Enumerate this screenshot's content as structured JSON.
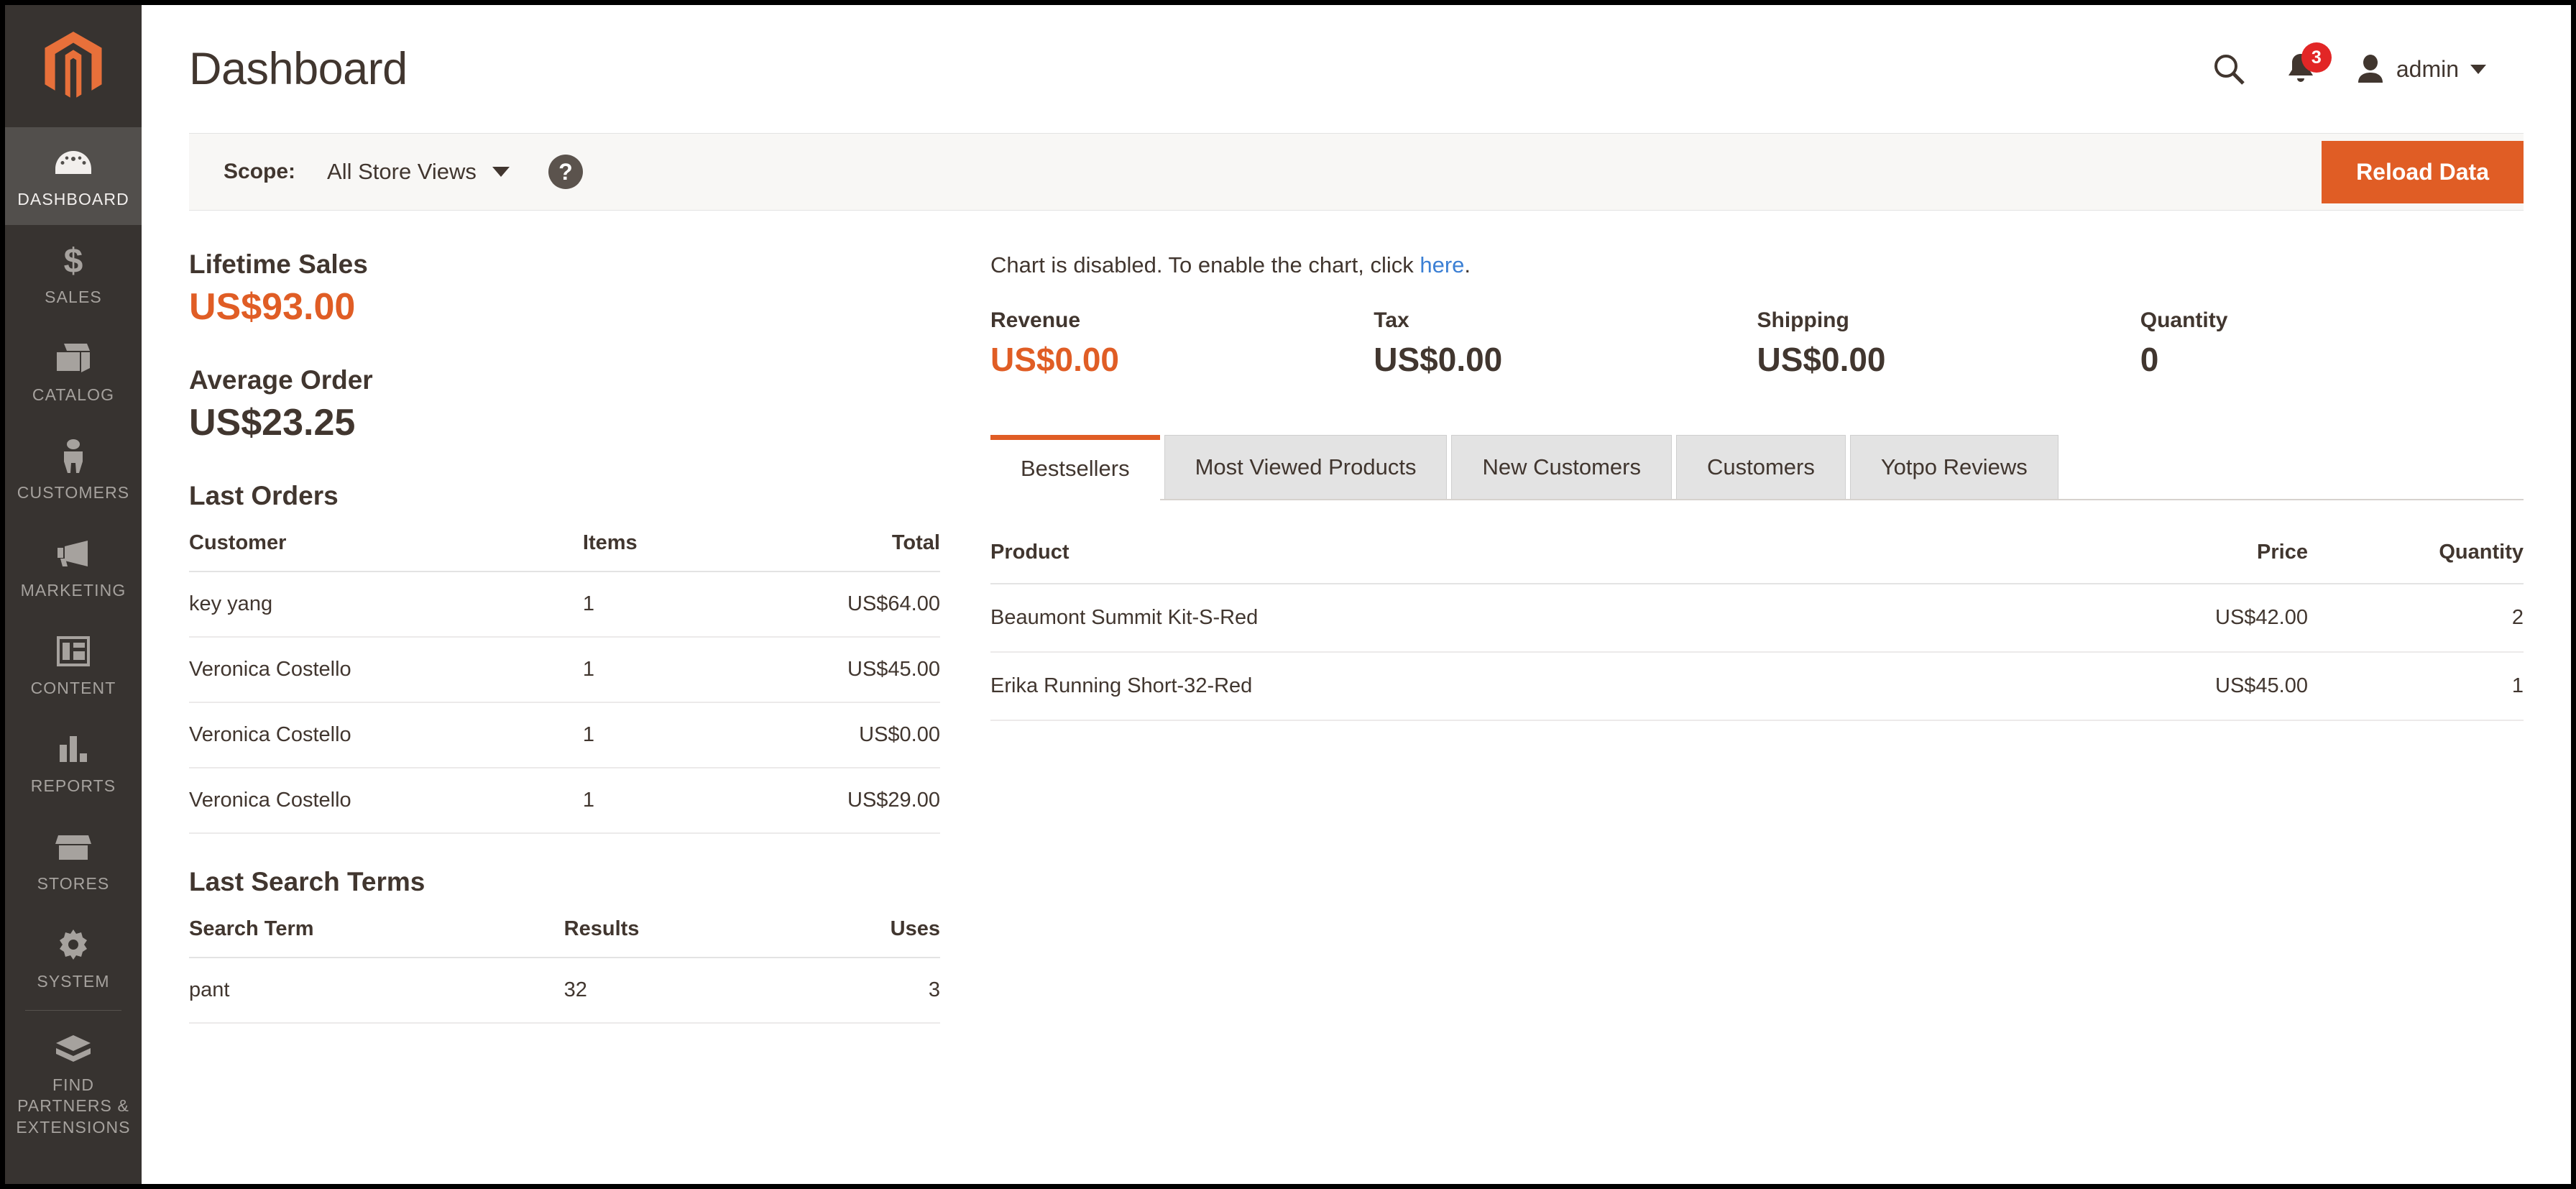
{
  "sidebar": {
    "logo": "magento-logo-icon",
    "items": [
      {
        "label": "DASHBOARD",
        "icon": "dashboard-gauge-icon",
        "active": true
      },
      {
        "label": "SALES",
        "icon": "dollar-sign-icon",
        "active": false
      },
      {
        "label": "CATALOG",
        "icon": "box-icon",
        "active": false
      },
      {
        "label": "CUSTOMERS",
        "icon": "person-icon",
        "active": false
      },
      {
        "label": "MARKETING",
        "icon": "megaphone-icon",
        "active": false
      },
      {
        "label": "CONTENT",
        "icon": "layout-page-icon",
        "active": false
      },
      {
        "label": "REPORTS",
        "icon": "bar-chart-icon",
        "active": false
      },
      {
        "label": "STORES",
        "icon": "storefront-icon",
        "active": false
      },
      {
        "label": "SYSTEM",
        "icon": "gear-icon",
        "active": false
      },
      {
        "label": "FIND PARTNERS & EXTENSIONS",
        "icon": "extensions-blocks-icon",
        "active": false
      }
    ]
  },
  "header": {
    "title": "Dashboard",
    "search_icon": "search-icon",
    "notifications_icon": "bell-icon",
    "notifications_count": "3",
    "user_icon": "user-avatar-icon",
    "user_name": "admin"
  },
  "scope": {
    "label": "Scope:",
    "value": "All Store Views",
    "help_icon": "question-mark-icon",
    "help_label": "?",
    "reload_label": "Reload Data"
  },
  "lifetime_sales": {
    "title": "Lifetime Sales",
    "value": "US$93.00"
  },
  "average_order": {
    "title": "Average Order",
    "value": "US$23.25"
  },
  "last_orders": {
    "title": "Last Orders",
    "columns": [
      "Customer",
      "Items",
      "Total"
    ],
    "rows": [
      {
        "customer": "key yang",
        "items": "1",
        "total": "US$64.00"
      },
      {
        "customer": "Veronica Costello",
        "items": "1",
        "total": "US$45.00"
      },
      {
        "customer": "Veronica Costello",
        "items": "1",
        "total": "US$0.00"
      },
      {
        "customer": "Veronica Costello",
        "items": "1",
        "total": "US$29.00"
      }
    ]
  },
  "last_search_terms": {
    "title": "Last Search Terms",
    "columns": [
      "Search Term",
      "Results",
      "Uses"
    ],
    "rows": [
      {
        "term": "pant",
        "results": "32",
        "uses": "3"
      }
    ]
  },
  "chart_notice": {
    "text_before": "Chart is disabled. To enable the chart, click ",
    "link": "here",
    "text_after": "."
  },
  "stats": [
    {
      "label": "Revenue",
      "value": "US$0.00",
      "accent": true
    },
    {
      "label": "Tax",
      "value": "US$0.00",
      "accent": false
    },
    {
      "label": "Shipping",
      "value": "US$0.00",
      "accent": false
    },
    {
      "label": "Quantity",
      "value": "0",
      "accent": false
    }
  ],
  "tabs": [
    {
      "label": "Bestsellers",
      "active": true
    },
    {
      "label": "Most Viewed Products",
      "active": false
    },
    {
      "label": "New Customers",
      "active": false
    },
    {
      "label": "Customers",
      "active": false
    },
    {
      "label": "Yotpo Reviews",
      "active": false
    }
  ],
  "bestsellers": {
    "columns": [
      "Product",
      "Price",
      "Quantity"
    ],
    "rows": [
      {
        "product": "Beaumont Summit Kit-S-Red",
        "price": "US$42.00",
        "quantity": "2"
      },
      {
        "product": "Erika Running Short-32-Red",
        "price": "US$45.00",
        "quantity": "1"
      }
    ]
  },
  "colors": {
    "accent_orange": "#e05d25",
    "sidebar_bg": "#373330",
    "sidebar_active": "#524f4c",
    "text_dark": "#41362f",
    "link_blue": "#3b7fd4",
    "badge_red": "#e22626"
  }
}
